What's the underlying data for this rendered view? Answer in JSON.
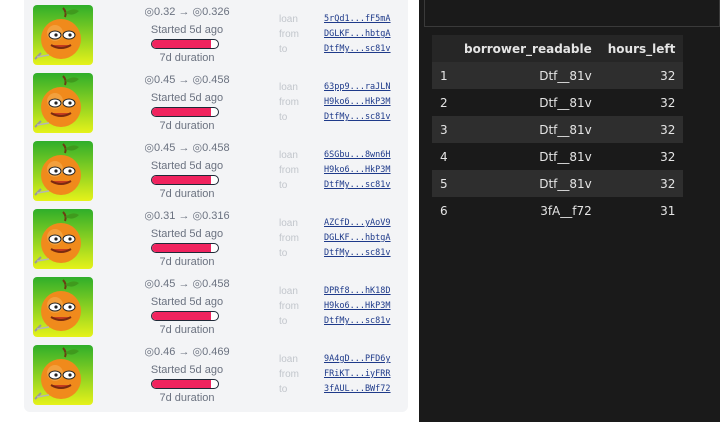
{
  "loans": [
    {
      "rate": "◎0.32 → ◎0.326",
      "started": "Started 5d ago",
      "progress": 0.9,
      "duration": "7d duration",
      "labels": [
        "loan",
        "from",
        "to"
      ],
      "addresses": [
        "5rQd1...fF5mA",
        "DGLKF...hbtgA",
        "DtfMy...sc81v"
      ]
    },
    {
      "rate": "◎0.45 → ◎0.458",
      "started": "Started 5d ago",
      "progress": 0.9,
      "duration": "7d duration",
      "labels": [
        "loan",
        "from",
        "to"
      ],
      "addresses": [
        "63pp9...raJLN",
        "H9ko6...HkP3M",
        "DtfMy...sc81v"
      ]
    },
    {
      "rate": "◎0.45 → ◎0.458",
      "started": "Started 5d ago",
      "progress": 0.9,
      "duration": "7d duration",
      "labels": [
        "loan",
        "from",
        "to"
      ],
      "addresses": [
        "6SGbu...8wn6H",
        "H9ko6...HkP3M",
        "DtfMy...sc81v"
      ]
    },
    {
      "rate": "◎0.31 → ◎0.316",
      "started": "Started 5d ago",
      "progress": 0.9,
      "duration": "7d duration",
      "labels": [
        "loan",
        "from",
        "to"
      ],
      "addresses": [
        "AZCfD...yAoV9",
        "DGLKF...hbtgA",
        "DtfMy...sc81v"
      ]
    },
    {
      "rate": "◎0.45 → ◎0.458",
      "started": "Started 5d ago",
      "progress": 0.9,
      "duration": "7d duration",
      "labels": [
        "loan",
        "from",
        "to"
      ],
      "addresses": [
        "DPRf8...hK18D",
        "H9ko6...HkP3M",
        "DtfMy...sc81v"
      ]
    },
    {
      "rate": "◎0.46 → ◎0.469",
      "started": "Started 5d ago",
      "progress": 0.9,
      "duration": "7d duration",
      "labels": [
        "loan",
        "from",
        "to"
      ],
      "addresses": [
        "9A4gD...PFD6y",
        "FRiKT...iyFRR",
        "3fAUL...BWf72"
      ]
    }
  ],
  "colors": {
    "progress_fill": "#f0235e",
    "avatar_bg_top": "#2fae2a",
    "avatar_bg_bottom": "#e6f21a",
    "address_link": "#1e3a8a"
  },
  "avatar_icon": "orange-character-icon",
  "table": {
    "columns": [
      "",
      "borrower_readable",
      "hours_left"
    ],
    "rows": [
      [
        "1",
        "Dtf__81v",
        "32"
      ],
      [
        "2",
        "Dtf__81v",
        "32"
      ],
      [
        "3",
        "Dtf__81v",
        "32"
      ],
      [
        "4",
        "Dtf__81v",
        "32"
      ],
      [
        "5",
        "Dtf__81v",
        "32"
      ],
      [
        "6",
        "3fA__f72",
        "31"
      ]
    ]
  }
}
